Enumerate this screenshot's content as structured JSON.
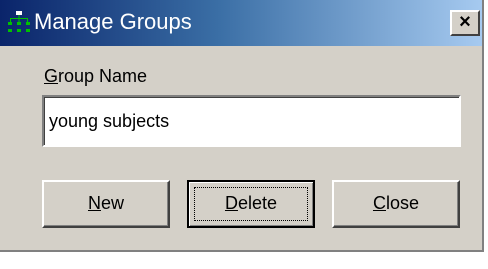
{
  "window": {
    "title": "Manage Groups",
    "icon": "groups-tree-icon",
    "close_glyph": "×"
  },
  "form": {
    "group_name_label": {
      "accesskey": "G",
      "rest": "roup Name"
    },
    "group_name_value": "young subjects"
  },
  "buttons": {
    "new": {
      "accesskey": "N",
      "rest": "ew"
    },
    "delete": {
      "accesskey": "D",
      "rest": "elete"
    },
    "close": {
      "accesskey": "C",
      "rest": "lose"
    }
  },
  "colors": {
    "titlebar_start": "#0a246a",
    "titlebar_end": "#a6caf0",
    "face": "#d4d0c8"
  }
}
